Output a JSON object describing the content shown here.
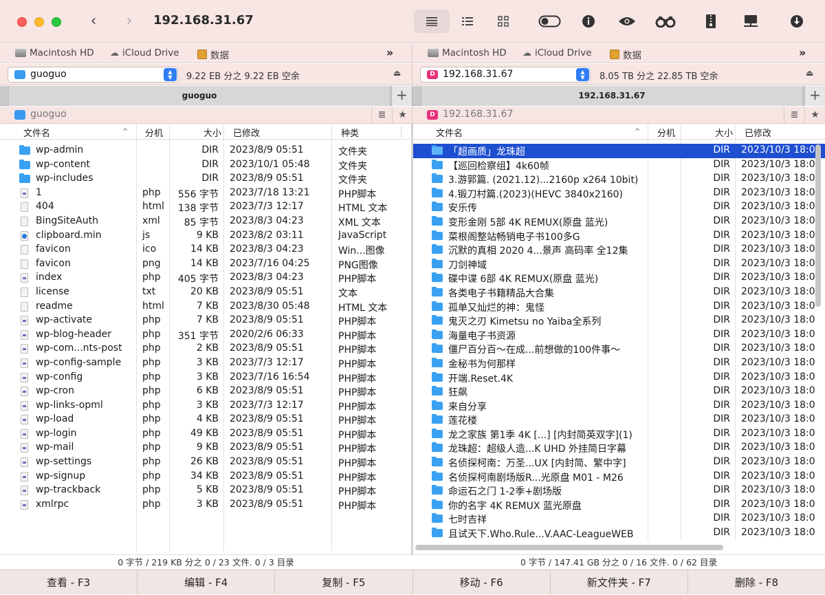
{
  "window": {
    "title": "192.168.31.67"
  },
  "favorites": [
    "Macintosh HD",
    "iCloud Drive",
    "数据"
  ],
  "left": {
    "drive": "guoguo",
    "drive_free": "9.22 EB 分之 9.22 EB 空余",
    "tab": "guoguo",
    "path": "guoguo",
    "columns": {
      "name": "文件名",
      "ext": "分机",
      "size": "大小",
      "modified": "已修改",
      "kind": "种类"
    },
    "files": [
      {
        "icon": "folder",
        "name": "wp-admin",
        "ext": "",
        "size": "DIR",
        "modified": "2023/8/9 05:51",
        "kind": "文件夹"
      },
      {
        "icon": "folder",
        "name": "wp-content",
        "ext": "",
        "size": "DIR",
        "modified": "2023/10/1 05:48",
        "kind": "文件夹"
      },
      {
        "icon": "folder",
        "name": "wp-includes",
        "ext": "",
        "size": "DIR",
        "modified": "2023/8/9 05:51",
        "kind": "文件夹"
      },
      {
        "icon": "php",
        "name": "1",
        "ext": "php",
        "size": "556 字节",
        "modified": "2023/7/18 13:21",
        "kind": "PHP脚本"
      },
      {
        "icon": "doc",
        "name": "404",
        "ext": "html",
        "size": "138 字节",
        "modified": "2023/7/3 12:17",
        "kind": "HTML 文本"
      },
      {
        "icon": "doc",
        "name": "BingSiteAuth",
        "ext": "xml",
        "size": "85 字节",
        "modified": "2023/8/3 04:23",
        "kind": "XML 文本"
      },
      {
        "icon": "js",
        "name": "clipboard.min",
        "ext": "js",
        "size": "9 KB",
        "modified": "2023/8/2 03:11",
        "kind": "JavaScript"
      },
      {
        "icon": "doc",
        "name": "favicon",
        "ext": "ico",
        "size": "14 KB",
        "modified": "2023/8/3 04:23",
        "kind": "Win...图像"
      },
      {
        "icon": "doc",
        "name": "favicon",
        "ext": "png",
        "size": "14 KB",
        "modified": "2023/7/16 04:25",
        "kind": "PNG图像"
      },
      {
        "icon": "php",
        "name": "index",
        "ext": "php",
        "size": "405 字节",
        "modified": "2023/8/3 04:23",
        "kind": "PHP脚本"
      },
      {
        "icon": "doc",
        "name": "license",
        "ext": "txt",
        "size": "20 KB",
        "modified": "2023/8/9 05:51",
        "kind": "文本"
      },
      {
        "icon": "doc",
        "name": "readme",
        "ext": "html",
        "size": "7 KB",
        "modified": "2023/8/30 05:48",
        "kind": "HTML 文本"
      },
      {
        "icon": "php",
        "name": "wp-activate",
        "ext": "php",
        "size": "7 KB",
        "modified": "2023/8/9 05:51",
        "kind": "PHP脚本"
      },
      {
        "icon": "php",
        "name": "wp-blog-header",
        "ext": "php",
        "size": "351 字节",
        "modified": "2020/2/6 06:33",
        "kind": "PHP脚本"
      },
      {
        "icon": "php",
        "name": "wp-com...nts-post",
        "ext": "php",
        "size": "2 KB",
        "modified": "2023/8/9 05:51",
        "kind": "PHP脚本"
      },
      {
        "icon": "php",
        "name": "wp-config-sample",
        "ext": "php",
        "size": "3 KB",
        "modified": "2023/7/3 12:17",
        "kind": "PHP脚本"
      },
      {
        "icon": "php",
        "name": "wp-config",
        "ext": "php",
        "size": "3 KB",
        "modified": "2023/7/16 16:54",
        "kind": "PHP脚本"
      },
      {
        "icon": "php",
        "name": "wp-cron",
        "ext": "php",
        "size": "6 KB",
        "modified": "2023/8/9 05:51",
        "kind": "PHP脚本"
      },
      {
        "icon": "php",
        "name": "wp-links-opml",
        "ext": "php",
        "size": "3 KB",
        "modified": "2023/7/3 12:17",
        "kind": "PHP脚本"
      },
      {
        "icon": "php",
        "name": "wp-load",
        "ext": "php",
        "size": "4 KB",
        "modified": "2023/8/9 05:51",
        "kind": "PHP脚本"
      },
      {
        "icon": "php",
        "name": "wp-login",
        "ext": "php",
        "size": "49 KB",
        "modified": "2023/8/9 05:51",
        "kind": "PHP脚本"
      },
      {
        "icon": "php",
        "name": "wp-mail",
        "ext": "php",
        "size": "9 KB",
        "modified": "2023/8/9 05:51",
        "kind": "PHP脚本"
      },
      {
        "icon": "php",
        "name": "wp-settings",
        "ext": "php",
        "size": "26 KB",
        "modified": "2023/8/9 05:51",
        "kind": "PHP脚本"
      },
      {
        "icon": "php",
        "name": "wp-signup",
        "ext": "php",
        "size": "34 KB",
        "modified": "2023/8/9 05:51",
        "kind": "PHP脚本"
      },
      {
        "icon": "php",
        "name": "wp-trackback",
        "ext": "php",
        "size": "5 KB",
        "modified": "2023/8/9 05:51",
        "kind": "PHP脚本"
      },
      {
        "icon": "php",
        "name": "xmlrpc",
        "ext": "php",
        "size": "3 KB",
        "modified": "2023/8/9 05:51",
        "kind": "PHP脚本"
      }
    ],
    "status": "0 字节 / 219 KB 分之 0 / 23 文件. 0 / 3 目录"
  },
  "right": {
    "drive": "192.168.31.67",
    "drive_free": "8.05 TB 分之 22.85 TB 空余",
    "tab": "192.168.31.67",
    "path": "192.168.31.67",
    "columns": {
      "name": "文件名",
      "ext": "分机",
      "size": "大小",
      "modified": "已修改"
    },
    "files": [
      {
        "name": "「超画质」龙珠超",
        "size": "DIR",
        "modified": "2023/10/3 18:0",
        "selected": true
      },
      {
        "name": "【巡回检察组】4k60帧",
        "size": "DIR",
        "modified": "2023/10/3 18:0"
      },
      {
        "name": "3.游郭篇. (2021.12)...2160p x264 10bit)",
        "size": "DIR",
        "modified": "2023/10/3 18:0"
      },
      {
        "name": "4.锻刀村篇.(2023)(HEVC 3840x2160)",
        "size": "DIR",
        "modified": "2023/10/3 18:0"
      },
      {
        "name": "安乐传",
        "size": "DIR",
        "modified": "2023/10/3 18:0"
      },
      {
        "name": "变形金刚 5部 4K REMUX(原盘 蓝光)",
        "size": "DIR",
        "modified": "2023/10/3 18:0"
      },
      {
        "name": "菜根阁整站畅销电子书100多G",
        "size": "DIR",
        "modified": "2023/10/3 18:0"
      },
      {
        "name": "沉默的真相 2020 4...景声 高码率 全12集",
        "size": "DIR",
        "modified": "2023/10/3 18:0"
      },
      {
        "name": "刀剑神域",
        "size": "DIR",
        "modified": "2023/10/3 18:0"
      },
      {
        "name": "碟中谍 6部 4K REMUX(原盘 蓝光)",
        "size": "DIR",
        "modified": "2023/10/3 18:0"
      },
      {
        "name": "各类电子书籍精品大合集",
        "size": "DIR",
        "modified": "2023/10/3 18:0"
      },
      {
        "name": "孤单又灿烂的神：鬼怪",
        "size": "DIR",
        "modified": "2023/10/3 18:0"
      },
      {
        "name": "鬼灭之刃 Kimetsu no Yaiba全系列",
        "size": "DIR",
        "modified": "2023/10/3 18:0"
      },
      {
        "name": "海量电子书资源",
        "size": "DIR",
        "modified": "2023/10/3 18:0"
      },
      {
        "name": "僵尸百分百～在成...前想做的100件事～",
        "size": "DIR",
        "modified": "2023/10/3 18:0"
      },
      {
        "name": "金秘书为何那样",
        "size": "DIR",
        "modified": "2023/10/3 18:0"
      },
      {
        "name": "开端.Reset.4K",
        "size": "DIR",
        "modified": "2023/10/3 18:0"
      },
      {
        "name": "狂飙",
        "size": "DIR",
        "modified": "2023/10/3 18:0"
      },
      {
        "name": "来自分享",
        "size": "DIR",
        "modified": "2023/10/3 18:0"
      },
      {
        "name": "莲花楼",
        "size": "DIR",
        "modified": "2023/10/3 18:0"
      },
      {
        "name": "龙之家族 第1季 4K [...] [内封简英双字](1)",
        "size": "DIR",
        "modified": "2023/10/3 18:0"
      },
      {
        "name": "龙珠超：超级人造...K UHD 外挂简日字幕",
        "size": "DIR",
        "modified": "2023/10/3 18:0"
      },
      {
        "name": "名侦探柯南：万圣...UX [内封简、繁中字]",
        "size": "DIR",
        "modified": "2023/10/3 18:0"
      },
      {
        "name": "名侦探柯南剧场版R...光原盘 M01 - M26",
        "size": "DIR",
        "modified": "2023/10/3 18:0"
      },
      {
        "name": "命运石之门 1-2季+剧场版",
        "size": "DIR",
        "modified": "2023/10/3 18:0"
      },
      {
        "name": "你的名字 4K REMUX 蓝光原盘",
        "size": "DIR",
        "modified": "2023/10/3 18:0"
      },
      {
        "name": "七时吉祥",
        "size": "DIR",
        "modified": "2023/10/3 18:0"
      },
      {
        "name": "且试天下.Who.Rule...V.AAC-LeagueWEB",
        "size": "DIR",
        "modified": "2023/10/3 18:0"
      }
    ],
    "status": "0 字节 / 147.41 GB 分之 0 / 16 文件. 0 / 62 目录"
  },
  "fkeys": [
    "查看 - F3",
    "编辑 - F4",
    "复制 - F5",
    "移动 - F6",
    "新文件夹 - F7",
    "删除 - F8"
  ],
  "colors": {
    "selection": "#1e4fd0",
    "titlebar": "#f7e6e4",
    "folder": "#3aa1f2"
  }
}
